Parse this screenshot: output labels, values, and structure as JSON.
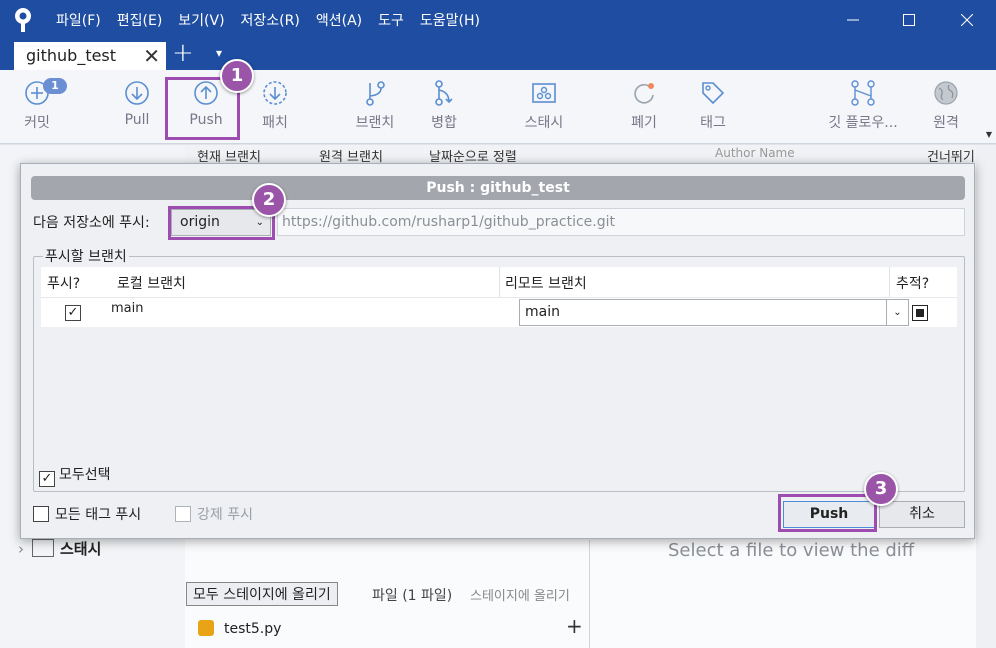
{
  "menu": [
    "파일(F)",
    "편집(E)",
    "보기(V)",
    "저장소(R)",
    "액션(A)",
    "도구",
    "도움말(H)"
  ],
  "tab": {
    "label": "github_test",
    "close": "✕",
    "add": "+",
    "menu": "▾"
  },
  "toolbar": {
    "commit": {
      "label": "커밋",
      "badge": "1",
      "icon": "plus-circle-icon"
    },
    "pull": {
      "label": "Pull",
      "icon": "arrow-down-circle-icon"
    },
    "push": {
      "label": "Push",
      "icon": "arrow-up-circle-icon"
    },
    "patch": {
      "label": "패치",
      "icon": "patch-icon"
    },
    "branch": {
      "label": "브랜치",
      "icon": "branch-icon"
    },
    "merge": {
      "label": "병합",
      "icon": "merge-icon"
    },
    "stash": {
      "label": "스태시",
      "icon": "stash-icon"
    },
    "discard": {
      "label": "폐기",
      "icon": "discard-icon"
    },
    "tag": {
      "label": "태그",
      "icon": "tag-icon"
    },
    "gitflow": {
      "label": "깃 플로우...",
      "icon": "git-flow-icon"
    },
    "remote": {
      "label": "원격",
      "icon": "globe-icon"
    }
  },
  "background": {
    "filter_current_branch": "현재 브랜치",
    "filter_remote_branch": "원격 브랜치",
    "sort_order": "날짜순으로 정렬",
    "author_placeholder": "Author Name",
    "skip_label": "건너뛰기:",
    "stash_label": "스태시",
    "stage_all": "모두 스테이지에 올리기",
    "file_count": "파일 (1 파일)",
    "unstage_all": "스테이지에 올리기",
    "diff_hint": "Select a file to view the diff",
    "file_name": "test5.py"
  },
  "dialog": {
    "title": "Push :  github_test",
    "remote_label": "다음 저장소에 푸시:",
    "remote_value": "origin",
    "remote_url": "https://github.com/rusharp1/github_practice.git",
    "group_label": "푸시할 브랜치",
    "columns": {
      "push": "푸시?",
      "local": "로컬 브랜치",
      "remote": "리모트 브랜치",
      "track": "추적?"
    },
    "rows": [
      {
        "push": true,
        "local": "main",
        "remote": "main",
        "track": true
      }
    ],
    "select_all": "모두선택",
    "push_all_tags": "모든 태그 푸시",
    "force_push": "강제 푸시",
    "push_button": "Push",
    "cancel_button": "취소"
  },
  "steps": [
    "1",
    "2",
    "3"
  ],
  "colors": {
    "titlebar": "#1e4da1",
    "highlight": "#9d4db0",
    "step_badge": "#9a55a8",
    "toolbar_icon": "#5b8fd1"
  }
}
